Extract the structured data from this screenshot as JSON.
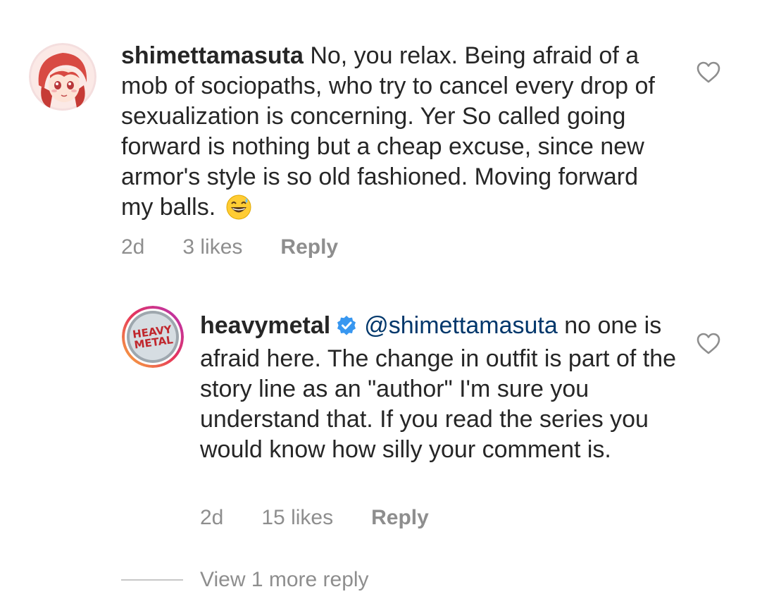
{
  "comments": [
    {
      "username": "shimettamasuta",
      "text": "No, you relax. Being afraid of a mob of sociopaths, who try to cancel every drop of sexualization is concerning. Yer So called going forward is nothing but a cheap excuse, since new armor's style is so old fashioned. Moving forward my balls.",
      "emoji": "grinning-sweat-emoji",
      "time": "2d",
      "likes": "3 likes",
      "reply_label": "Reply",
      "like_icon": "heart-outline-icon"
    }
  ],
  "replies": [
    {
      "username": "heavymetal",
      "verified": true,
      "mention": "@shimettamasuta",
      "text": "no one is afraid here. The change in outfit is part of the story line as an \"author\" I'm sure you understand that. If you read the series you would know how silly your comment is.",
      "time": "2d",
      "likes": "15 likes",
      "reply_label": "Reply",
      "like_icon": "heart-outline-icon",
      "avatar_text": "HEAVY METAL"
    }
  ],
  "view_more": "View 1 more reply",
  "colors": {
    "text": "#262626",
    "meta": "#8e8e8e",
    "mention": "#00376b",
    "verified": "#3897f0"
  }
}
